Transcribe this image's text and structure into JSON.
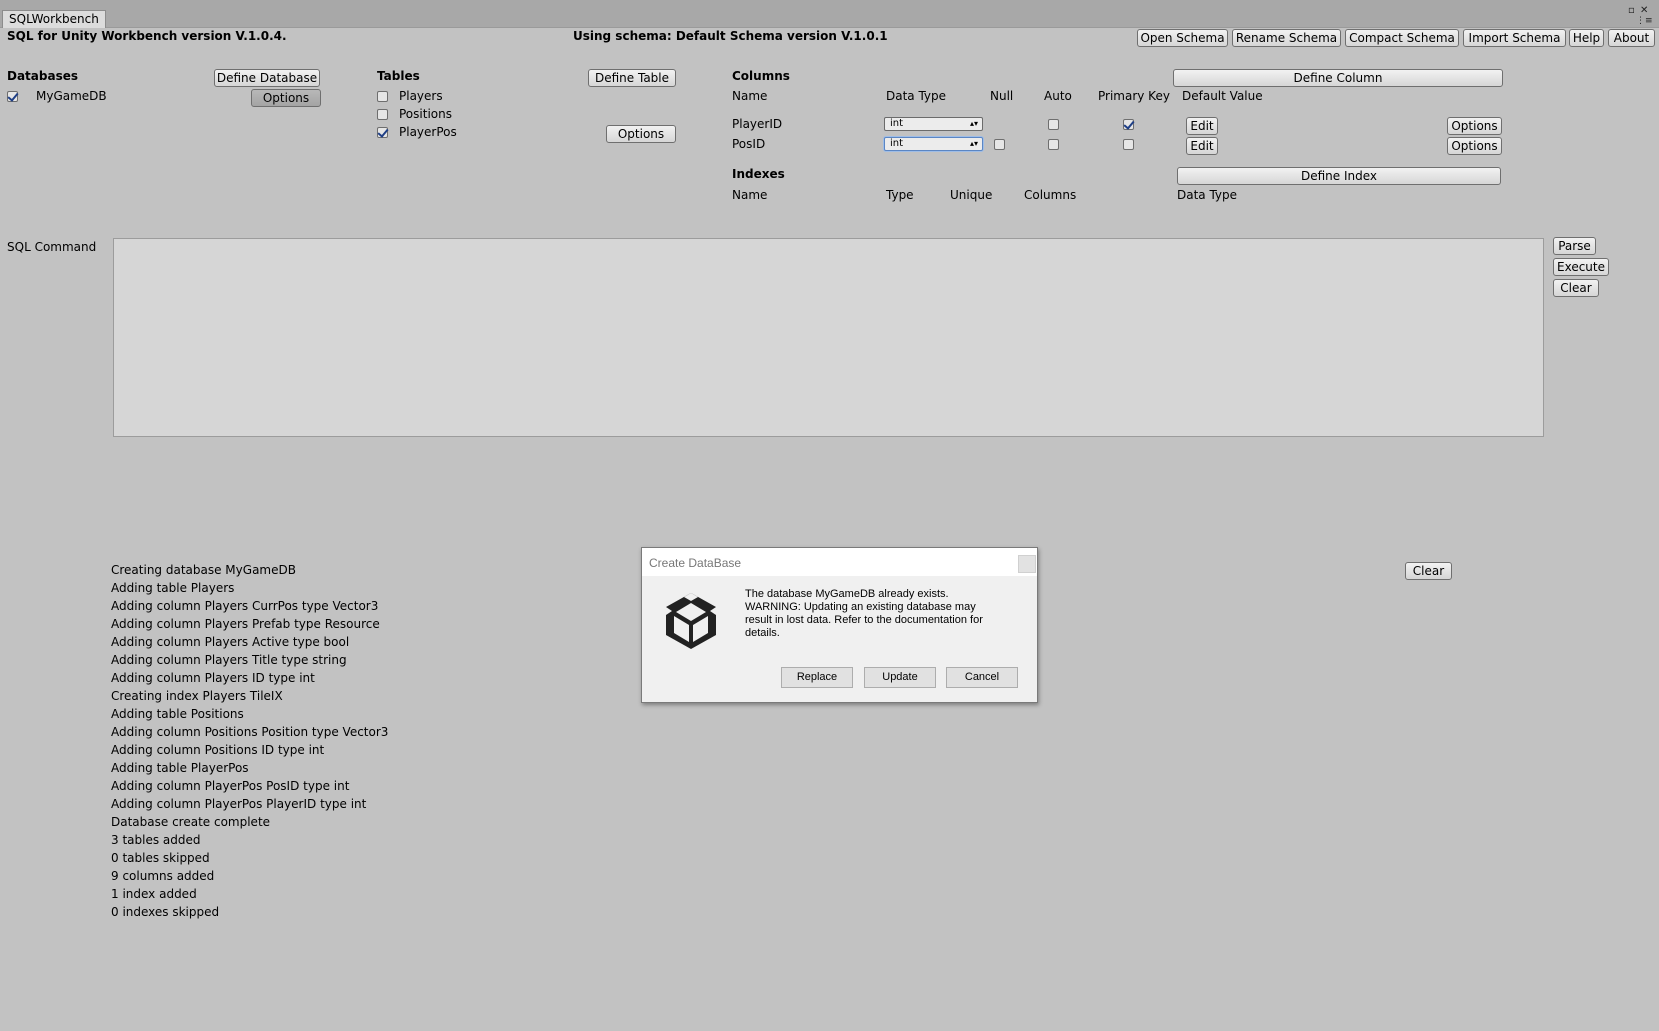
{
  "tab": {
    "label": "SQLWorkbench"
  },
  "header": {
    "version": "SQL for Unity Workbench version V.1.0.4.",
    "schema": "Using schema: Default Schema version V.1.0.1",
    "buttons": {
      "open_schema": "Open Schema",
      "rename_schema": "Rename Schema",
      "compact_schema": "Compact Schema",
      "import_schema": "Import Schema",
      "help": "Help",
      "about": "About"
    }
  },
  "databases": {
    "title": "Databases",
    "define_button": "Define Database",
    "options_button": "Options",
    "items": [
      {
        "name": "MyGameDB",
        "checked": true
      }
    ]
  },
  "tables": {
    "title": "Tables",
    "define_button": "Define Table",
    "options_button": "Options",
    "items": [
      {
        "name": "Players",
        "checked": false
      },
      {
        "name": "Positions",
        "checked": false
      },
      {
        "name": "PlayerPos",
        "checked": true
      }
    ]
  },
  "columns": {
    "title": "Columns",
    "define_button": "Define Column",
    "headers": {
      "name": "Name",
      "data_type": "Data Type",
      "null": "Null",
      "auto": "Auto",
      "primary_key": "Primary Key",
      "default_value": "Default Value"
    },
    "rows": [
      {
        "name": "PlayerID",
        "type": "int",
        "null": false,
        "auto": false,
        "pk": true,
        "edit": "Edit",
        "options": "Options"
      },
      {
        "name": "PosID",
        "type": "int",
        "null": false,
        "auto": false,
        "pk": false,
        "edit": "Edit",
        "options": "Options"
      }
    ]
  },
  "indexes": {
    "title": "Indexes",
    "define_button": "Define Index",
    "headers": {
      "name": "Name",
      "type": "Type",
      "unique": "Unique",
      "columns": "Columns",
      "data_type": "Data Type"
    }
  },
  "sql": {
    "label": "SQL Command",
    "value": "",
    "parse": "Parse",
    "execute": "Execute",
    "clear": "Clear"
  },
  "log": {
    "clear": "Clear",
    "lines": [
      "Creating database MyGameDB",
      "Adding table Players",
      "Adding column Players CurrPos type Vector3",
      "Adding column Players Prefab type Resource",
      "Adding column Players Active type bool",
      "Adding column Players Title type string",
      "Adding column Players ID type int",
      "Creating index Players TileIX",
      "Adding table Positions",
      "Adding column Positions Position type Vector3",
      "Adding column Positions ID type int",
      "Adding table PlayerPos",
      "Adding column PlayerPos PosID type int",
      "Adding column PlayerPos PlayerID type int",
      "Database create complete",
      "3 tables added",
      "0 tables skipped",
      "9 columns added",
      "1 index added",
      "0 indexes skipped"
    ]
  },
  "dialog": {
    "title": "Create DataBase",
    "message": "The database MyGameDB already exists. WARNING: Updating an existing database may result in lost data. Refer to the documentation for details.",
    "icon": "unity-logo",
    "replace": "Replace",
    "update": "Update",
    "cancel": "Cancel"
  }
}
